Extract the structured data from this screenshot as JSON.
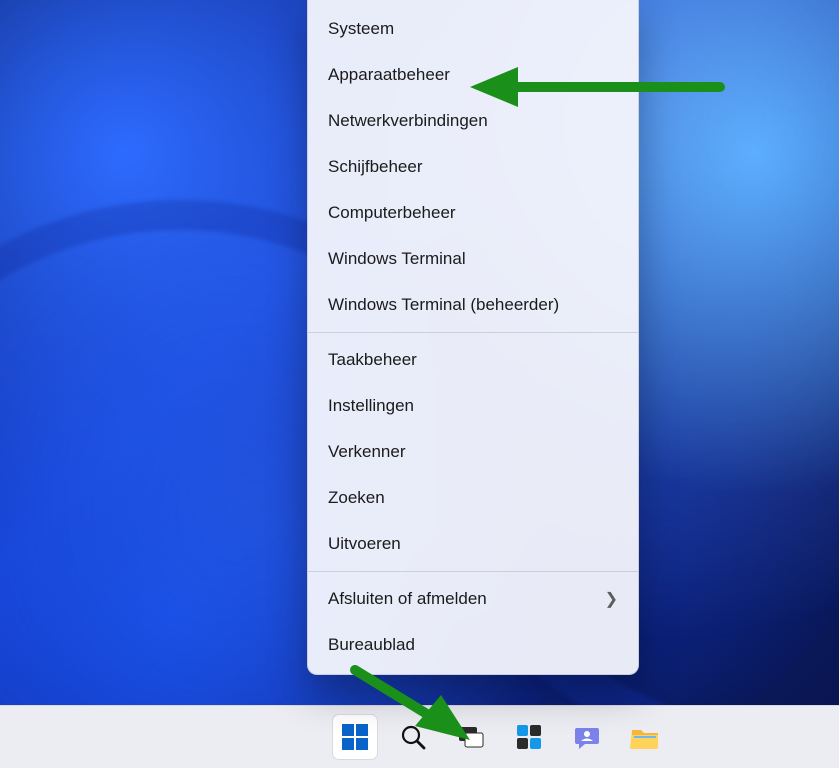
{
  "menu": {
    "items": [
      {
        "label": "Systeem"
      },
      {
        "label": "Apparaatbeheer"
      },
      {
        "label": "Netwerkverbindingen"
      },
      {
        "label": "Schijfbeheer"
      },
      {
        "label": "Computerbeheer"
      },
      {
        "label": "Windows Terminal"
      },
      {
        "label": "Windows Terminal (beheerder)"
      }
    ],
    "items2": [
      {
        "label": "Taakbeheer"
      },
      {
        "label": "Instellingen"
      },
      {
        "label": "Verkenner"
      },
      {
        "label": "Zoeken"
      },
      {
        "label": "Uitvoeren"
      }
    ],
    "items3": [
      {
        "label": "Afsluiten of afmelden",
        "submenu": true
      },
      {
        "label": "Bureaublad"
      }
    ]
  },
  "taskbar": {
    "icons": [
      "start",
      "search",
      "taskview",
      "widgets",
      "chat",
      "explorer"
    ]
  },
  "annotation_color": "#1a8f1a"
}
